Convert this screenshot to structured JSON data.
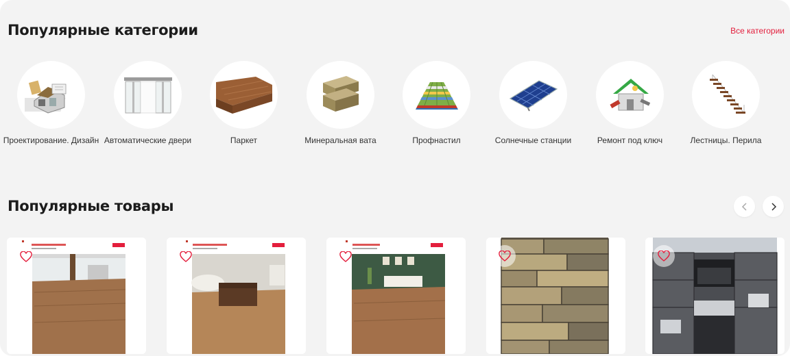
{
  "categories_section": {
    "title": "Популярные категории",
    "all_link": "Все категории",
    "items": [
      {
        "label": "Проектирование. Дизайн",
        "icon": "house-blueprint-icon"
      },
      {
        "label": "Автоматические двери",
        "icon": "sliding-door-icon"
      },
      {
        "label": "Паркет",
        "icon": "parquet-icon"
      },
      {
        "label": "Минеральная вата",
        "icon": "mineral-wool-icon"
      },
      {
        "label": "Профнастил",
        "icon": "corrugated-sheet-icon"
      },
      {
        "label": "Солнечные станции",
        "icon": "solar-panel-icon"
      },
      {
        "label": "Ремонт под ключ",
        "icon": "house-repair-icon"
      },
      {
        "label": "Лестницы. Перила",
        "icon": "staircase-icon"
      }
    ]
  },
  "products_section": {
    "title": "Популярные товары",
    "prev_icon": "chevron-left-icon",
    "next_icon": "chevron-right-icon",
    "products": [
      {
        "image": "laminate-floor-photo",
        "favorite_icon": "heart-icon"
      },
      {
        "image": "laminate-floor-photo",
        "favorite_icon": "heart-icon"
      },
      {
        "image": "laminate-floor-photo",
        "favorite_icon": "heart-icon"
      },
      {
        "image": "paving-stone-photo",
        "favorite_icon": "heart-icon"
      },
      {
        "image": "facade-building-photo",
        "favorite_icon": "heart-icon"
      }
    ]
  },
  "colors": {
    "accent": "#e31e3c",
    "background": "#f3f3f3"
  }
}
